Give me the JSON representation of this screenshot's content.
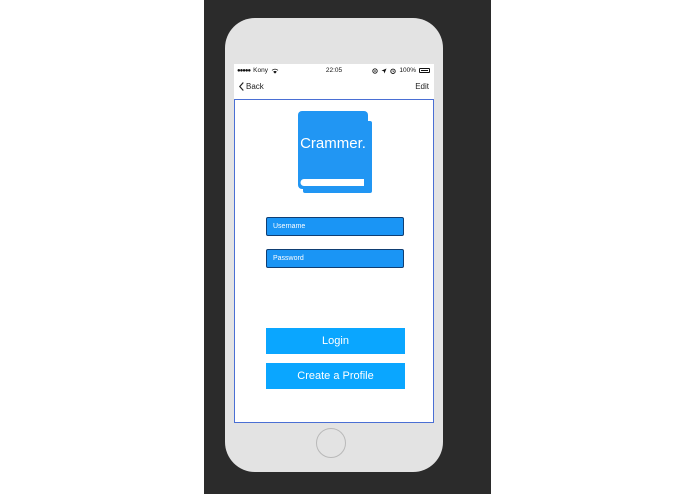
{
  "status_bar": {
    "signal": "●●●●●",
    "carrier": "Kony",
    "time": "22:05",
    "battery_percent": "100%"
  },
  "nav": {
    "back_label": "Back",
    "edit_label": "Edit"
  },
  "logo": {
    "text": "Crammer."
  },
  "form": {
    "username_placeholder": "Username",
    "password_placeholder": "Password"
  },
  "buttons": {
    "login_label": "Login",
    "create_profile_label": "Create a Profile"
  },
  "colors": {
    "accent": "#0aa6ff",
    "input_fill": "#1a95f5",
    "logo_blue": "#2196f3",
    "frame_border": "#4a6fd4"
  }
}
